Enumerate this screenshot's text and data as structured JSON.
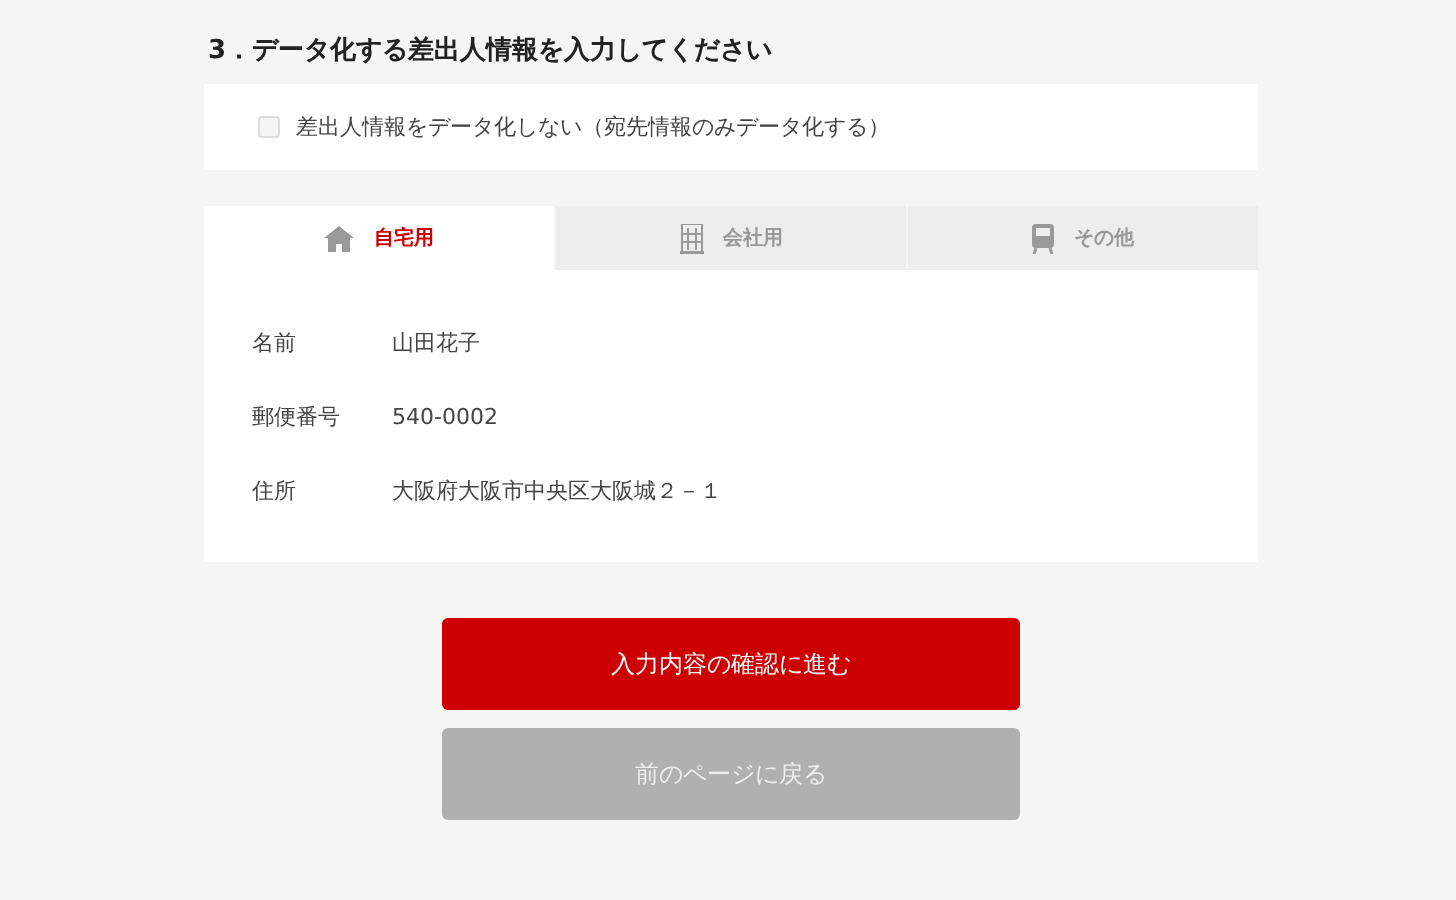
{
  "heading": "3．データ化する差出人情報を入力してください",
  "option": {
    "label": "差出人情報をデータ化しない（宛先情報のみデータ化する）",
    "checked": false
  },
  "tabs": [
    {
      "label": "自宅用",
      "kind": "house",
      "selected": true
    },
    {
      "label": "会社用",
      "kind": "building",
      "selected": false
    },
    {
      "label": "その他",
      "kind": "train",
      "selected": false
    }
  ],
  "fields": [
    {
      "label": "名前",
      "value": "山田花子"
    },
    {
      "label": "郵便番号",
      "value": "540-0002"
    },
    {
      "label": "住所",
      "value": "大阪府大阪市中央区大阪城２－１"
    }
  ],
  "buttons": [
    {
      "label": "入力内容の確認に進む",
      "kind": "primary"
    },
    {
      "label": "前のページに戻る",
      "kind": "secondary"
    }
  ]
}
